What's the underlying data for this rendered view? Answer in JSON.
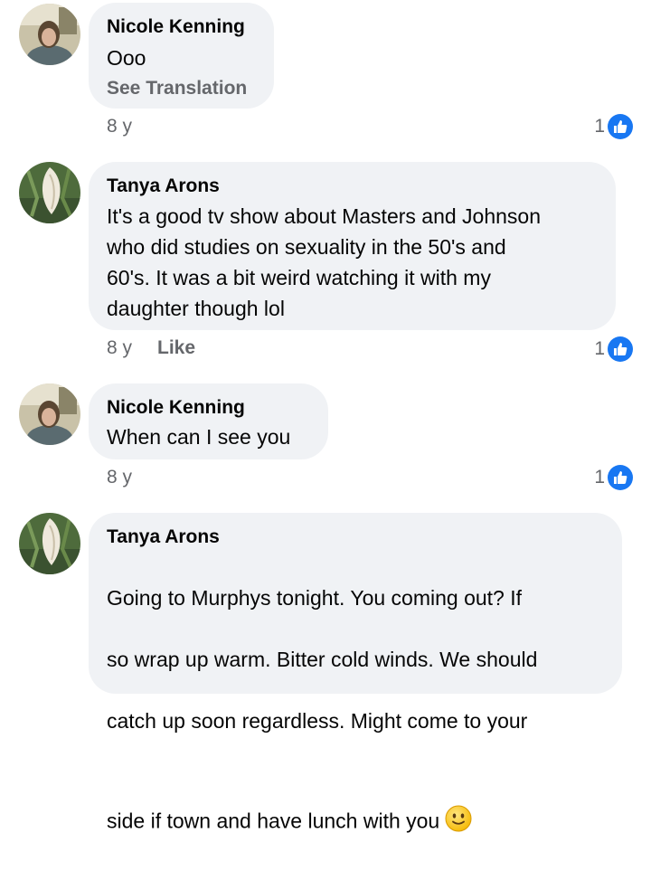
{
  "comments": [
    {
      "author": "Nicole Kenning",
      "text": "Ooo",
      "see_translation": "See Translation",
      "time": "8 y",
      "like_label": "",
      "reaction_count": "1",
      "avatar_icon": "profile-photo-woman"
    },
    {
      "author": "Tanya Arons",
      "text": "It's a good tv show about Masters and Johnson\nwho did studies on sexuality in the 50's and\n60's.  It was a bit weird watching it with my\ndaughter though lol",
      "see_translation": "",
      "time": "8 y",
      "like_label": "Like",
      "reaction_count": "1",
      "avatar_icon": "profile-photo-calla-lily"
    },
    {
      "author": "Nicole Kenning",
      "text": "When can I see you",
      "see_translation": "",
      "time": "8 y",
      "like_label": "",
      "reaction_count": "1",
      "avatar_icon": "profile-photo-woman"
    },
    {
      "author": "Tanya Arons",
      "text_lines": [
        "Going to Murphys tonight.  You coming out?  If",
        "so wrap up warm.  Bitter cold winds.  We should",
        "catch up soon regardless.  Might come to your"
      ],
      "text_last": "side if town and have lunch with you",
      "emoji_icon": "slightly-smiling-face",
      "avatar_icon": "profile-photo-calla-lily"
    }
  ],
  "colors": {
    "bubble": "#f0f2f5",
    "meta_text": "#65676b",
    "like_blue": "#1877f2"
  },
  "icons": {
    "reaction": "thumbs-up-icon"
  }
}
